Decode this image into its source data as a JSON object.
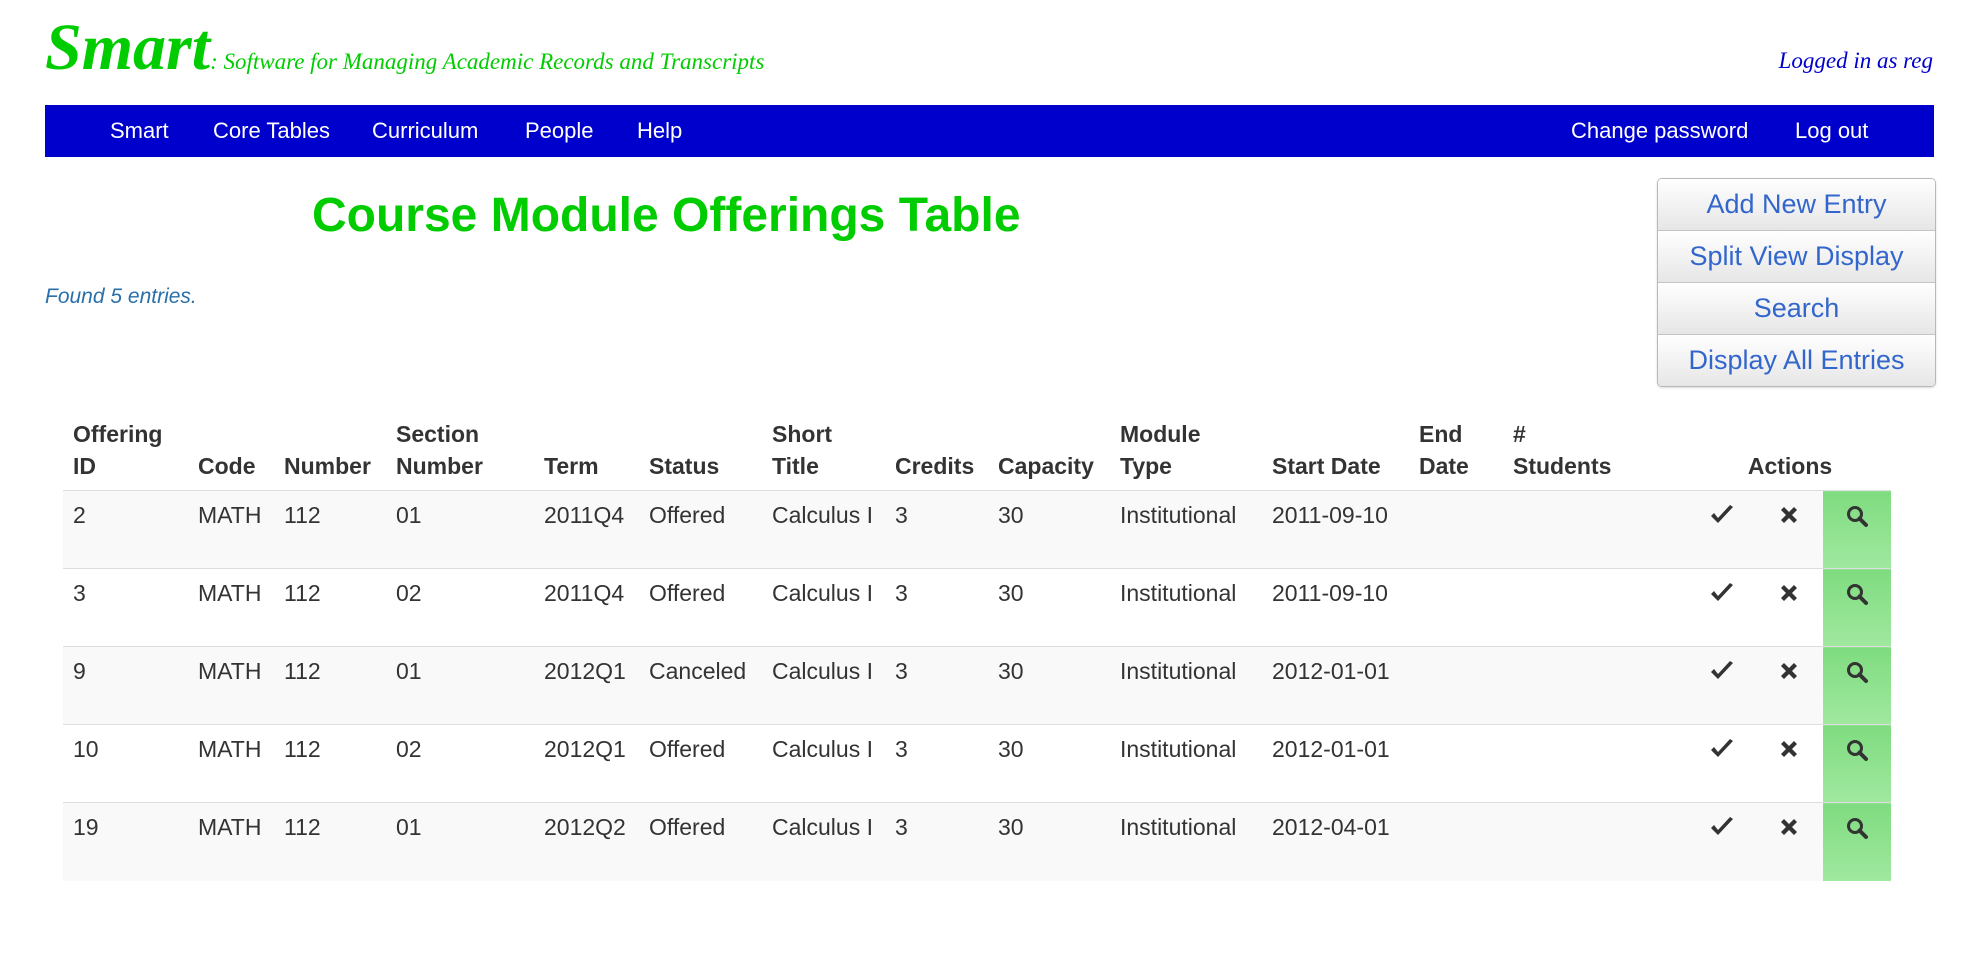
{
  "header": {
    "logo": "Smart",
    "tagline": ": Software for Managing Academic Records and Transcripts",
    "logged_in": "Logged in as reg"
  },
  "nav": {
    "left": [
      "Smart",
      "Core Tables",
      "Curriculum",
      "People",
      "Help"
    ],
    "right": [
      "Change password",
      "Log out"
    ]
  },
  "page": {
    "title": "Course Module Offerings Table",
    "found": "Found 5 entries."
  },
  "buttons": [
    "Add New Entry",
    "Split View Display",
    "Search",
    "Display All Entries"
  ],
  "table": {
    "columns": [
      [
        "Offering",
        "ID"
      ],
      [
        "",
        "Code"
      ],
      [
        "",
        "Number"
      ],
      [
        "Section",
        "Number"
      ],
      [
        "",
        "Term"
      ],
      [
        "",
        "Status"
      ],
      [
        "Short",
        "Title"
      ],
      [
        "",
        "Credits"
      ],
      [
        "",
        "Capacity"
      ],
      [
        "Module",
        "Type"
      ],
      [
        "",
        "Start Date"
      ],
      [
        "End",
        "Date"
      ],
      [
        "#",
        "Students"
      ]
    ],
    "actions_label": "Actions",
    "rows": [
      [
        "2",
        "MATH",
        "112",
        "01",
        "2011Q4",
        "Offered",
        "Calculus I",
        "3",
        "30",
        "Institutional",
        "2011-09-10",
        "",
        ""
      ],
      [
        "3",
        "MATH",
        "112",
        "02",
        "2011Q4",
        "Offered",
        "Calculus I",
        "3",
        "30",
        "Institutional",
        "2011-09-10",
        "",
        ""
      ],
      [
        "9",
        "MATH",
        "112",
        "01",
        "2012Q1",
        "Canceled",
        "Calculus I",
        "3",
        "30",
        "Institutional",
        "2012-01-01",
        "",
        ""
      ],
      [
        "10",
        "MATH",
        "112",
        "02",
        "2012Q1",
        "Offered",
        "Calculus I",
        "3",
        "30",
        "Institutional",
        "2012-01-01",
        "",
        ""
      ],
      [
        "19",
        "MATH",
        "112",
        "01",
        "2012Q2",
        "Offered",
        "Calculus I",
        "3",
        "30",
        "Institutional",
        "2012-04-01",
        "",
        ""
      ]
    ],
    "row_actions": [
      "edit-icon",
      "delete-icon",
      "view-icon"
    ]
  },
  "colors": {
    "brand_green": "#00cc00",
    "nav_blue": "#0000cc",
    "link_blue": "#3366cc",
    "view_green": "#8fe28f"
  }
}
